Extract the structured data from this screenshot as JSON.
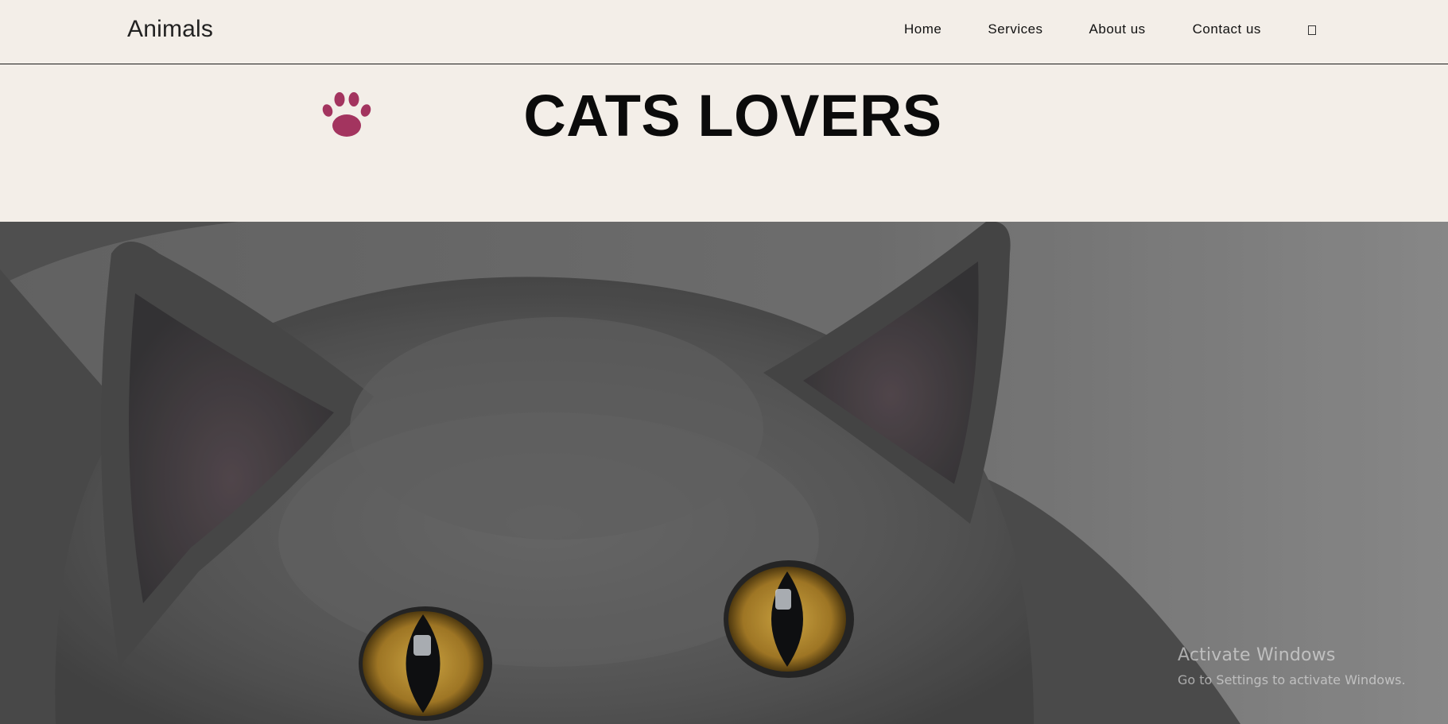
{
  "header": {
    "brand": "Animals",
    "nav": [
      {
        "label": "Home"
      },
      {
        "label": "Services"
      },
      {
        "label": "About us"
      },
      {
        "label": "Contact us"
      }
    ],
    "extra_icon": "search-icon"
  },
  "hero": {
    "title": "CATS LOVERS",
    "logo_icon": "paw-icon",
    "logo_color": "#a3345f",
    "image": "gray-cat-photo"
  },
  "watermark": {
    "title": "Activate Windows",
    "subtitle": "Go to Settings to activate Windows."
  }
}
